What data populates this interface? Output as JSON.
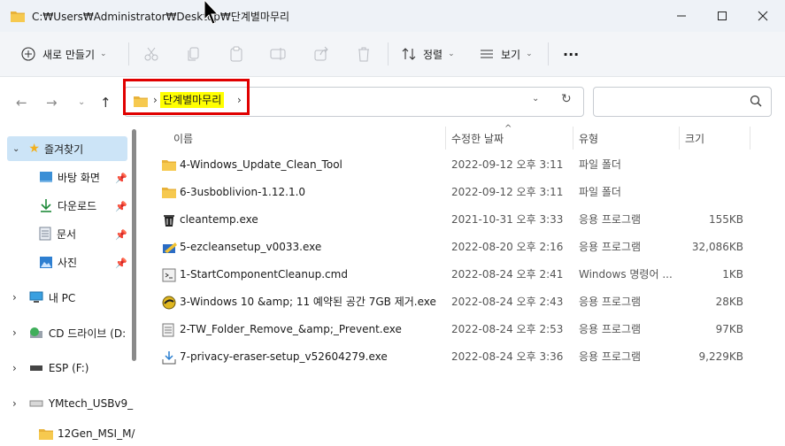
{
  "window": {
    "title": "C:₩Users₩Administrator₩Desktop₩단계별마무리"
  },
  "toolbar": {
    "new_label": "새로 만들기",
    "sort_label": "정렬",
    "view_label": "보기",
    "more_label": "···"
  },
  "address": {
    "crumb": "단계별마무리",
    "search_placeholder": ""
  },
  "sidebar": {
    "items": [
      {
        "label": "즐겨찾기"
      },
      {
        "label": "바탕 화면"
      },
      {
        "label": "다운로드"
      },
      {
        "label": "문서"
      },
      {
        "label": "사진"
      },
      {
        "label": "내 PC"
      },
      {
        "label": "CD 드라이브 (D:"
      },
      {
        "label": "ESP (F:)"
      },
      {
        "label": "YMtech_USBv9_"
      },
      {
        "label": "12Gen_MSI_M/"
      }
    ]
  },
  "columns": {
    "name": "이름",
    "date": "수정한 날짜",
    "type": "유형",
    "size": "크기"
  },
  "files": [
    {
      "name": "4-Windows_Update_Clean_Tool",
      "date": "2022-09-12 오후 3:11",
      "type": "파일 폴더",
      "size": "",
      "icon": "folder-icon"
    },
    {
      "name": "6-3usboblivion-1.12.1.0",
      "date": "2022-09-12 오후 3:11",
      "type": "파일 폴더",
      "size": "",
      "icon": "folder-icon"
    },
    {
      "name": "cleantemp.exe",
      "date": "2021-10-31 오후 3:33",
      "type": "응용 프로그램",
      "size": "155KB",
      "icon": "trash-app-icon"
    },
    {
      "name": "5-ezcleansetup_v0033.exe",
      "date": "2022-08-20 오후 2:16",
      "type": "응용 프로그램",
      "size": "32,086KB",
      "icon": "installer-icon"
    },
    {
      "name": "1-StartComponentCleanup.cmd",
      "date": "2022-08-24 오후 2:41",
      "type": "Windows 명령어 ...",
      "size": "1KB",
      "icon": "cmd-icon"
    },
    {
      "name": "3-Windows 10 &amp; 11 예약된 공간 7GB 제거.exe",
      "date": "2022-08-24 오후 2:43",
      "type": "응용 프로그램",
      "size": "28KB",
      "icon": "disc-app-icon"
    },
    {
      "name": "2-TW_Folder_Remove_&amp;_Prevent.exe",
      "date": "2022-08-24 오후 2:53",
      "type": "응용 프로그램",
      "size": "97KB",
      "icon": "document-app-icon"
    },
    {
      "name": "7-privacy-eraser-setup_v52604279.exe",
      "date": "2022-08-24 오후 3:36",
      "type": "응용 프로그램",
      "size": "9,229KB",
      "icon": "download-app-icon"
    }
  ],
  "colors": {
    "accent_red": "#e00000",
    "highlight": "#ffff00",
    "folder": "#f4c24d",
    "selection": "#cce4f7"
  }
}
